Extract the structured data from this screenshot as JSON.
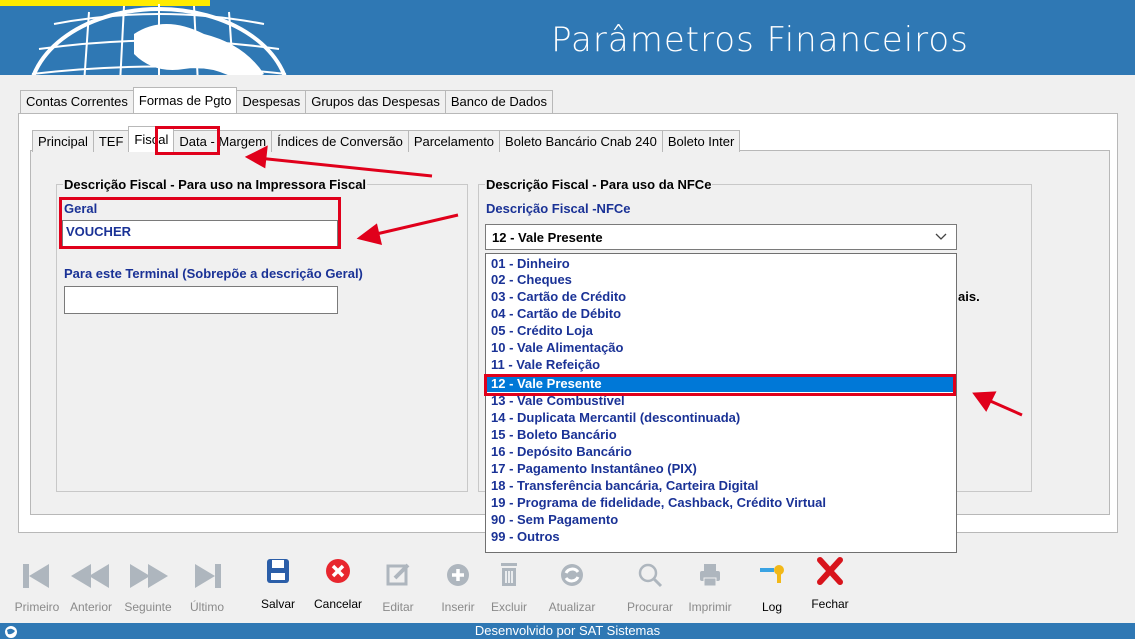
{
  "header": {
    "title": "Parâmetros Financeiros"
  },
  "main_tabs": [
    {
      "label": "Contas Correntes"
    },
    {
      "label": "Formas de Pgto"
    },
    {
      "label": "Despesas"
    },
    {
      "label": "Grupos das Despesas"
    },
    {
      "label": "Banco de Dados"
    }
  ],
  "sub_tabs": [
    {
      "label": "Principal"
    },
    {
      "label": "TEF"
    },
    {
      "label": "Fiscal"
    },
    {
      "label": "Data - Margem"
    },
    {
      "label": "Índices de Conversão"
    },
    {
      "label": "Parcelamento"
    },
    {
      "label": "Boleto Bancário Cnab 240"
    },
    {
      "label": "Boleto Inter"
    }
  ],
  "left_group": {
    "title": "Descrição Fiscal - Para uso na Impressora Fiscal",
    "general_label": "Geral",
    "general_value": "VOUCHER",
    "terminal_label": "Para este Terminal (Sobrepõe a descrição Geral)",
    "terminal_value": ""
  },
  "right_group": {
    "title": "Descrição Fiscal - Para uso da NFCe",
    "nfce_label": "Descrição Fiscal -NFCe",
    "selected_value": "12 - Vale Presente",
    "partial_text": "ais.",
    "options": [
      "01 - Dinheiro",
      "02 - Cheques",
      "03 - Cartão de Crédito",
      "04 - Cartão de Débito",
      "05 - Crédito Loja",
      "10 - Vale Alimentação",
      "11 - Vale Refeição",
      "12 - Vale Presente",
      "13 - Vale Combustível",
      "14 - Duplicata Mercantil (descontinuada)",
      "15 - Boleto Bancário",
      "16 - Depósito Bancário",
      "17 - Pagamento Instantâneo (PIX)",
      "18 - Transferência bancária, Carteira Digital",
      "19 - Programa de fidelidade, Cashback, Crédito Virtual",
      "90 - Sem Pagamento",
      "99 - Outros"
    ]
  },
  "toolbar": {
    "first": "Primeiro",
    "previous": "Anterior",
    "next": "Seguinte",
    "last": "Último",
    "save": "Salvar",
    "cancel": "Cancelar",
    "edit": "Editar",
    "insert": "Inserir",
    "delete": "Excluir",
    "refresh": "Atualizar",
    "search": "Procurar",
    "print": "Imprimir",
    "log": "Log",
    "close": "Fechar"
  },
  "status": {
    "text": "Desenvolvido por SAT Sistemas"
  },
  "colors": {
    "header_blue": "#2f78b4",
    "label_blue": "#1a3296",
    "highlight_red": "#e0001b",
    "selection_blue": "#0078d7"
  }
}
